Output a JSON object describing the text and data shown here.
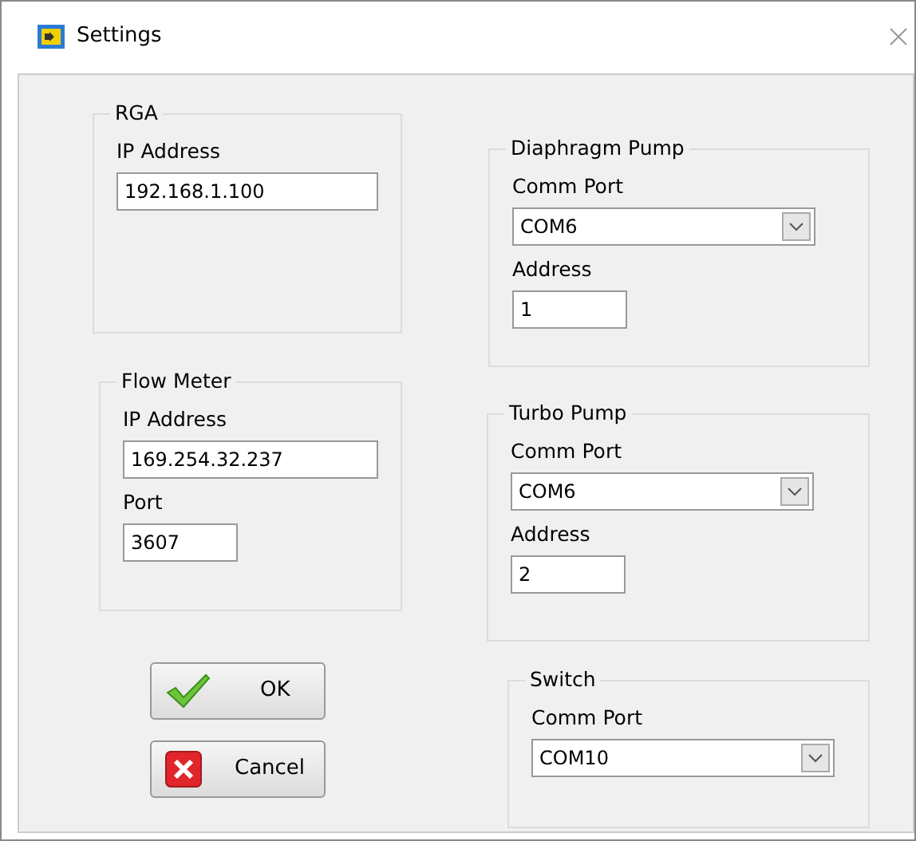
{
  "window": {
    "title": "Settings"
  },
  "left_groups": [
    {
      "title": "RGA",
      "fields": [
        {
          "kind": "text",
          "label": "IP Address",
          "value": "192.168.1.100"
        }
      ]
    },
    {
      "title": "Flow Meter",
      "fields": [
        {
          "kind": "text",
          "label": "IP Address",
          "value": "169.254.32.237"
        },
        {
          "kind": "short",
          "label": "Port",
          "value": "3607"
        }
      ]
    }
  ],
  "buttons": [
    {
      "kind": "ok",
      "label": "OK"
    },
    {
      "kind": "cancel",
      "label": "Cancel"
    }
  ],
  "right_groups": [
    {
      "title": "Diaphragm Pump",
      "fields": [
        {
          "kind": "select",
          "label": "Comm Port",
          "value": "COM6"
        },
        {
          "kind": "short",
          "label": "Address",
          "value": "1"
        }
      ]
    },
    {
      "title": "Turbo Pump",
      "fields": [
        {
          "kind": "select",
          "label": "Comm Port",
          "value": "COM6"
        },
        {
          "kind": "short",
          "label": "Address",
          "value": "2"
        }
      ]
    },
    {
      "title": "Switch",
      "fields": [
        {
          "kind": "select",
          "label": "Comm Port",
          "value": "COM10"
        }
      ]
    }
  ]
}
